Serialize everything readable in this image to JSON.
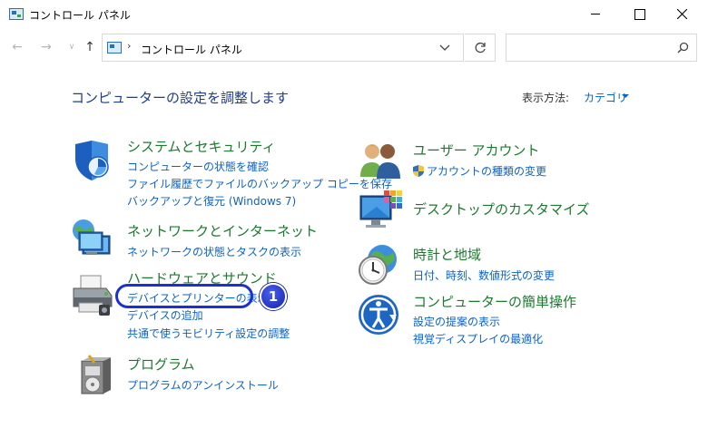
{
  "window": {
    "title": "コントロール パネル"
  },
  "address_bar": {
    "separator": "›",
    "crumb": "コントロール パネル"
  },
  "search": {
    "placeholder": "",
    "value": ""
  },
  "header": {
    "title": "コンピューターの設定を調整します",
    "view_by_label": "表示方法:",
    "view_by_value": "カテゴリ"
  },
  "categories": {
    "system_security": {
      "title": "システムとセキュリティ",
      "links": [
        "コンピューターの状態を確認",
        "ファイル履歴でファイルのバックアップ コピーを保存",
        "バックアップと復元 (Windows 7)"
      ]
    },
    "network": {
      "title": "ネットワークとインターネット",
      "links": [
        "ネットワークの状態とタスクの表示"
      ]
    },
    "hardware": {
      "title": "ハードウェアとサウンド",
      "links": [
        "デバイスとプリンターの表示",
        "デバイスの追加",
        "共通で使うモビリティ設定の調整"
      ]
    },
    "programs": {
      "title": "プログラム",
      "links": [
        "プログラムのアンインストール"
      ]
    },
    "user_accounts": {
      "title": "ユーザー アカウント",
      "links": [
        "アカウントの種類の変更"
      ]
    },
    "appearance": {
      "title": "デスクトップのカスタマイズ",
      "links": []
    },
    "clock_region": {
      "title": "時計と地域",
      "links": [
        "日付、時刻、数値形式の変更"
      ]
    },
    "ease_of_access": {
      "title": "コンピューターの簡単操作",
      "links": [
        "設定の提案の表示",
        "視覚ディスプレイの最適化"
      ]
    }
  },
  "annotation": {
    "badge_number": "1"
  },
  "colors": {
    "category_title": "#1b7a2e",
    "link": "#0b63c7",
    "highlight": "#1a2fd6"
  }
}
